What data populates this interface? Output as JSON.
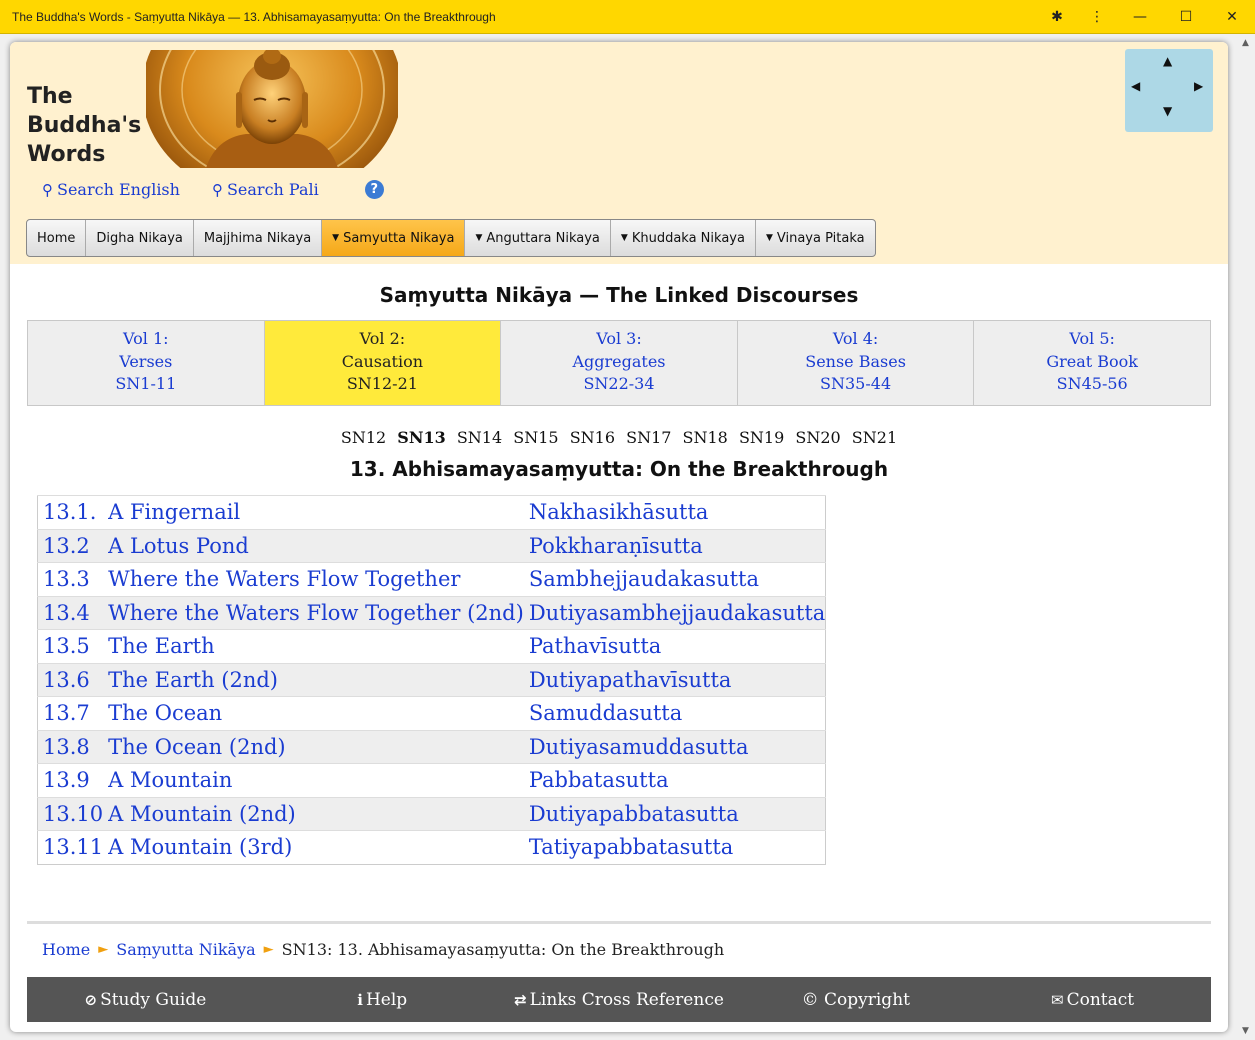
{
  "window": {
    "title": "The Buddha's Words - Saṃyutta Nikāya — 13. Abhisamayasaṃyutta: On the Breakthrough",
    "controls": {
      "extensions": "✱",
      "menu": "⋮",
      "minimize": "—",
      "maximize": "☐",
      "close": "✕"
    }
  },
  "site": {
    "name_line1": "The",
    "name_line2": "Buddha's",
    "name_line3": "Words",
    "search_english": "Search English",
    "search_pali": "Search Pali",
    "help": "?",
    "nav_pad": {
      "up": "▲",
      "left": "◀",
      "right": "▶",
      "down": "▼"
    }
  },
  "menu": {
    "home": "Home",
    "digha": "Digha Nikaya",
    "majjhima": "Majjhima Nikaya",
    "samyutta": "Samyutta Nikaya",
    "anguttara": "Anguttara Nikaya",
    "khuddaka": "Khuddaka Nikaya",
    "vinaya": "Vinaya Pitaka",
    "caret": "▼"
  },
  "page_title": "Saṃyutta Nikāya — The Linked Discourses",
  "volumes": [
    {
      "l1": "Vol 1:",
      "l2": "Verses",
      "l3": "SN1-11"
    },
    {
      "l1": "Vol 2:",
      "l2": "Causation",
      "l3": "SN12-21"
    },
    {
      "l1": "Vol 3:",
      "l2": "Aggregates",
      "l3": "SN22-34"
    },
    {
      "l1": "Vol 4:",
      "l2": "Sense Bases",
      "l3": "SN35-44"
    },
    {
      "l1": "Vol 5:",
      "l2": "Great Book",
      "l3": "SN45-56"
    }
  ],
  "sn_links": [
    "SN12",
    "SN13",
    "SN14",
    "SN15",
    "SN16",
    "SN17",
    "SN18",
    "SN19",
    "SN20",
    "SN21"
  ],
  "chapter_title": "13. Abhisamayasaṃyutta: On the Breakthrough",
  "suttas": [
    {
      "num": "13.1.",
      "english": "A Fingernail",
      "pali": "Nakhasikhāsutta"
    },
    {
      "num": "13.2",
      "english": "A Lotus Pond",
      "pali": "Pokkharaṇīsutta"
    },
    {
      "num": "13.3",
      "english": "Where the Waters Flow Together",
      "pali": "Sambhejjaudakasutta"
    },
    {
      "num": "13.4",
      "english": "Where the Waters Flow Together (2nd)",
      "pali": "Dutiyasambhejjaudakasutta"
    },
    {
      "num": "13.5",
      "english": "The Earth",
      "pali": "Pathavīsutta"
    },
    {
      "num": "13.6",
      "english": "The Earth (2nd)",
      "pali": "Dutiyapathavīsutta"
    },
    {
      "num": "13.7",
      "english": "The Ocean",
      "pali": "Samuddasutta"
    },
    {
      "num": "13.8",
      "english": "The Ocean (2nd)",
      "pali": "Dutiyasamuddasutta"
    },
    {
      "num": "13.9",
      "english": "A Mountain",
      "pali": "Pabbatasutta"
    },
    {
      "num": "13.10",
      "english": "A Mountain (2nd)",
      "pali": "Dutiyapabbatasutta"
    },
    {
      "num": "13.11",
      "english": "A Mountain (3rd)",
      "pali": "Tatiyapabbatasutta"
    }
  ],
  "breadcrumb": {
    "home": "Home",
    "section": "Saṃyutta Nikāya",
    "current": "SN13: 13. Abhisamayasaṃyutta: On the Breakthrough",
    "sep": "►"
  },
  "footer": {
    "study_guide": "Study Guide",
    "help": "Help",
    "links": "Links Cross Reference",
    "copyright": "© Copyright",
    "contact": "Contact"
  },
  "colors": {
    "titlebar": "#ffd700",
    "header_bg": "#fff1cf",
    "link": "#1a3cd1",
    "active_vol": "#ffea3b",
    "active_menu": "#f5a818",
    "footer_bg": "#555555"
  }
}
